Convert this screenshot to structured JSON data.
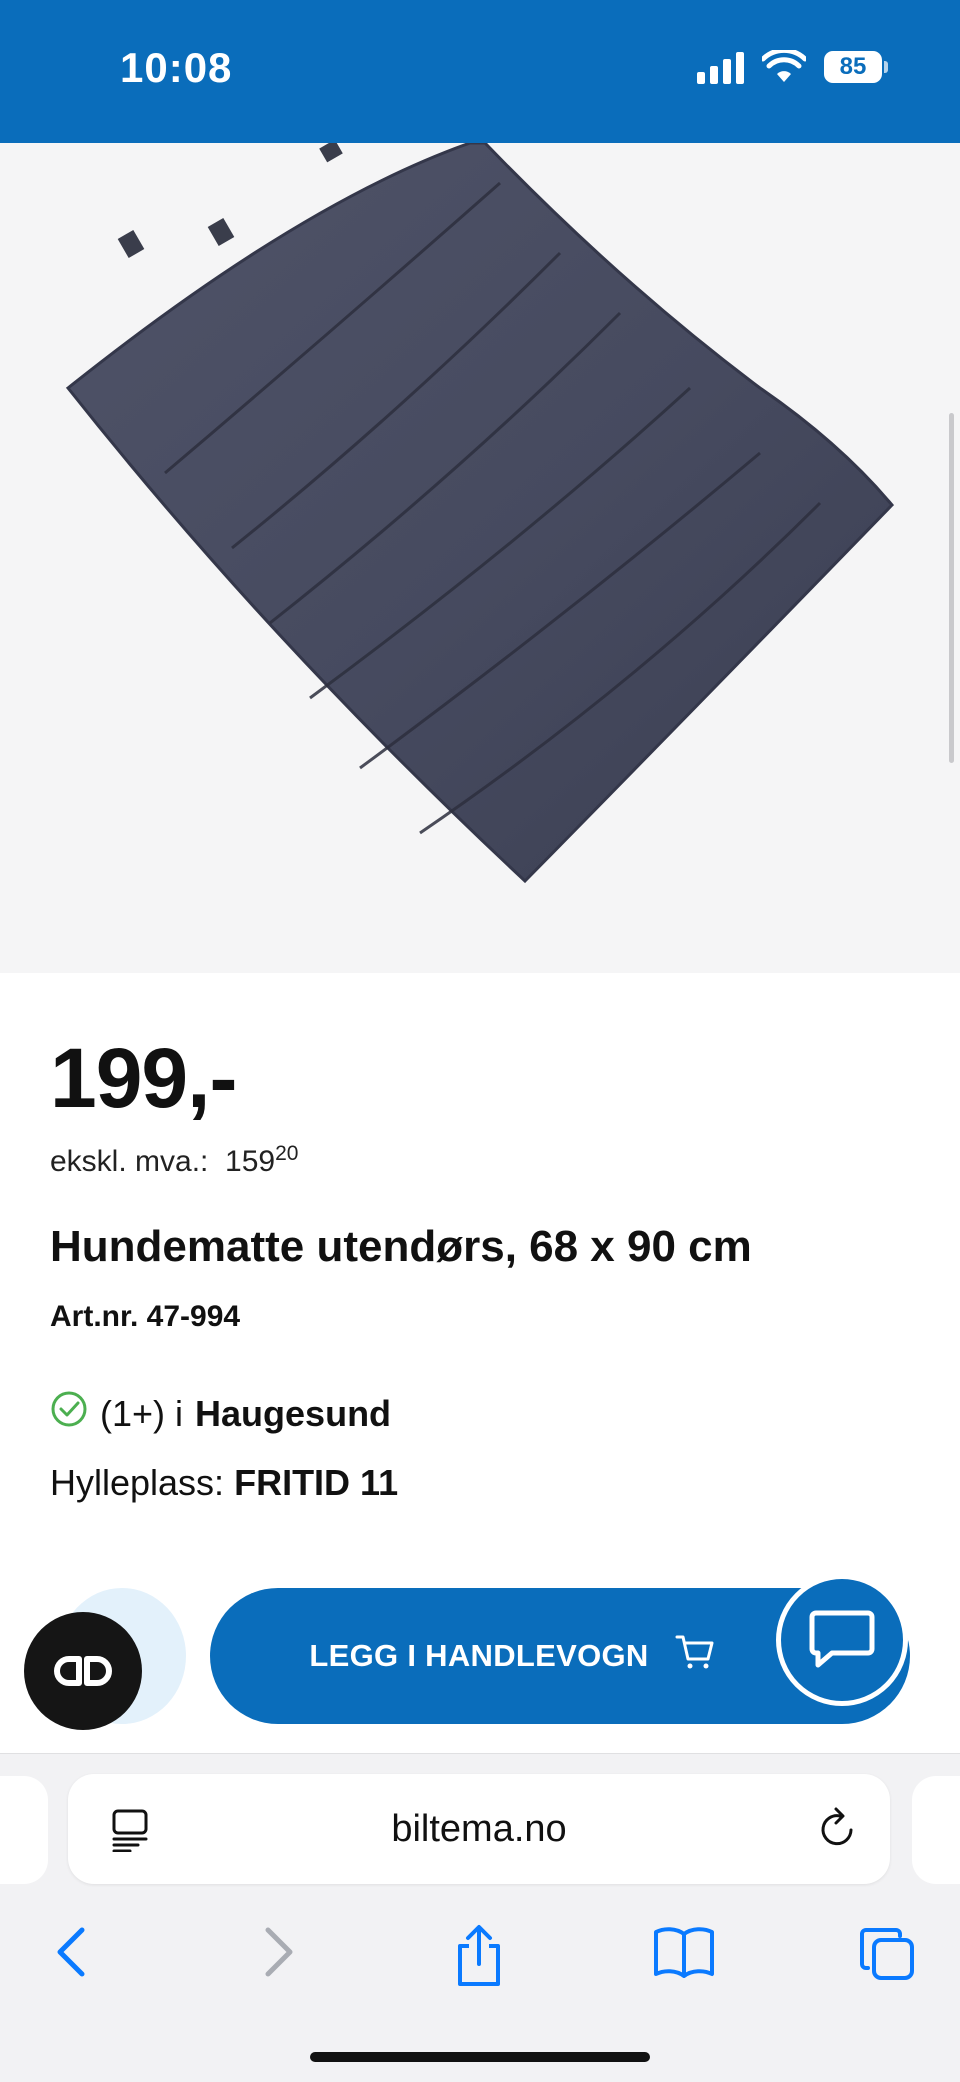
{
  "status_bar": {
    "time": "10:08",
    "battery": "85"
  },
  "product": {
    "price": "199,-",
    "price_ex_vat_label": "ekskl. mva.:",
    "price_ex_vat_whole": "159",
    "price_ex_vat_cents": "20",
    "title": "Hundematte utendørs, 68 x 90 cm",
    "article_number": "Art.nr. 47-994",
    "stock_count": "(1+) i",
    "stock_store": "Haugesund",
    "shelf_label": "Hylleplass:",
    "shelf_value": "FRITID 11"
  },
  "actions": {
    "add_to_cart_label": "LEGG I HANDLEVOGN"
  },
  "browser": {
    "url": "biltema.no"
  },
  "colors": {
    "brand_blue": "#0a6dbb",
    "stock_green": "#4caf50",
    "ios_blue": "#0a7aff"
  }
}
